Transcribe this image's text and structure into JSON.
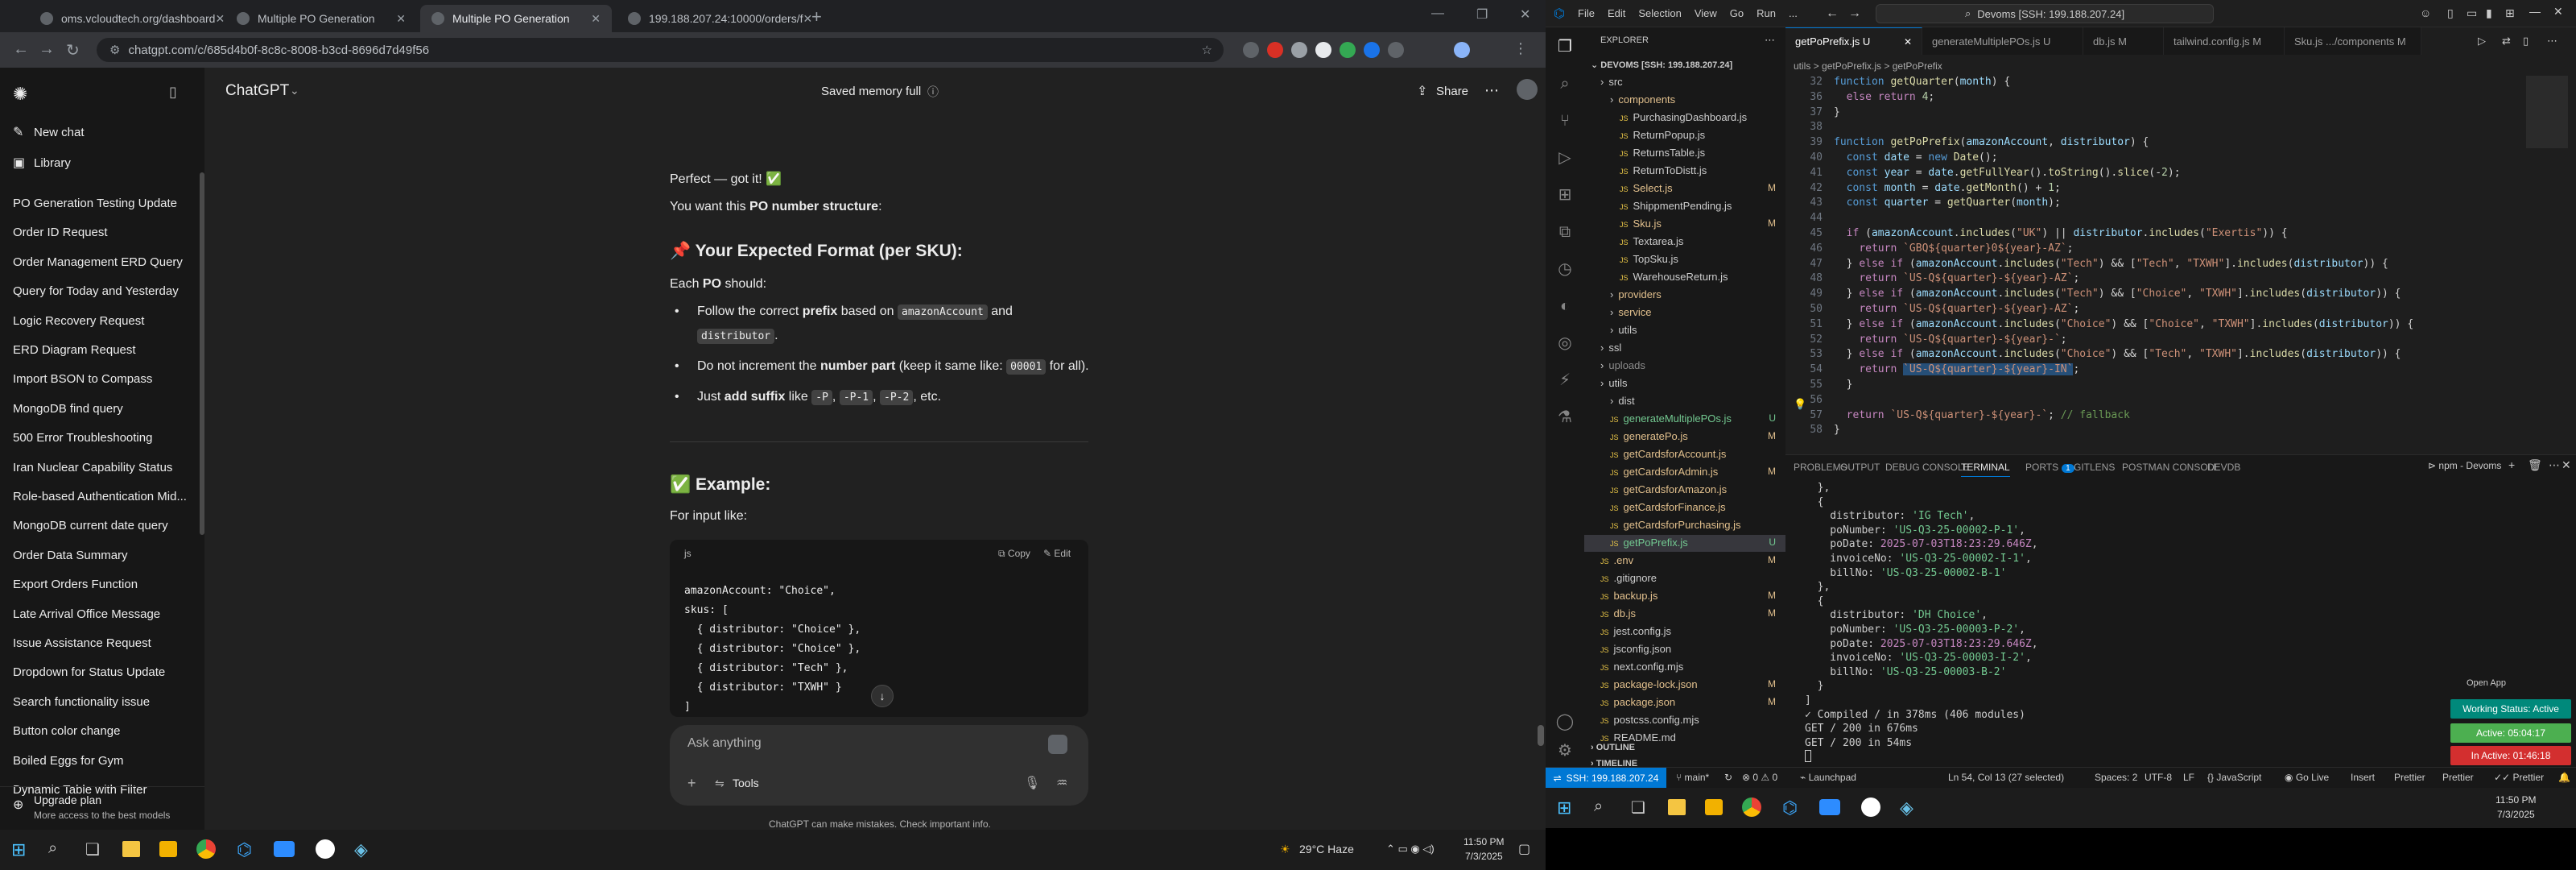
{
  "chrome": {
    "tabs": [
      {
        "label": "oms.vcloudtech.org/dashboard",
        "active": false
      },
      {
        "label": "Multiple PO Generation",
        "active": false
      },
      {
        "label": "Multiple PO Generation",
        "active": true
      },
      {
        "label": "199.188.207.24:10000/orders/f",
        "active": false
      }
    ],
    "new_tab": "+",
    "window_min": "—",
    "window_max": "❐",
    "window_close": "✕",
    "url": "chatgpt.com/c/685d4b0f-8c8c-8008-b3cd-8696d7d49f56"
  },
  "chatgpt": {
    "model_label": "ChatGPT",
    "memory_label": "Saved memory full",
    "share_label": "Share",
    "sidebar": {
      "new_chat": "New chat",
      "library": "Library",
      "chats": [
        "PO Generation Testing Update",
        "Order ID Request",
        "Order Management ERD Query",
        "Query for Today and Yesterday",
        "Logic Recovery Request",
        "ERD Diagram Request",
        "Import BSON to Compass",
        "MongoDB find query",
        "500 Error Troubleshooting",
        "Iran Nuclear Capability Status",
        "Role-based Authentication Mid...",
        "MongoDB current date query",
        "Order Data Summary",
        "Export Orders Function",
        "Late Arrival Office Message",
        "Issue Assistance Request",
        "Dropdown for Status Update",
        "Search functionality issue",
        "Button color change",
        "Boiled Eggs for Gym",
        "Dynamic Table with Filter"
      ],
      "upgrade_title": "Upgrade plan",
      "upgrade_sub": "More access to the best models"
    },
    "message": {
      "line1": "Perfect — got it! ✅",
      "line2_pre": "You want this ",
      "line2_bold": "PO number structure",
      "line2_post": ":",
      "heading1": "📌 Your Expected Format (per SKU):",
      "each_pre": "Each ",
      "each_bold": "PO",
      "each_post": " should:",
      "bullet1_pre": "Follow the correct ",
      "bullet1_bold": "prefix",
      "bullet1_mid": " based on ",
      "bullet1_code1": "amazonAccount",
      "bullet1_and": " and",
      "bullet1_code2": "distributor",
      "bullet1_end": ".",
      "bullet2_pre": "Do not increment the ",
      "bullet2_bold": "number part",
      "bullet2_mid": " (keep it same like: ",
      "bullet2_code": "00001",
      "bullet2_end": " for all).",
      "bullet3_pre": "Just ",
      "bullet3_bold": "add suffix",
      "bullet3_mid": " like ",
      "bullet3_c1": "-P",
      "bullet3_c2": "-P-1",
      "bullet3_c3": "-P-2",
      "bullet3_end": ", etc.",
      "heading2": "✅ Example:",
      "for_input": "For input like:"
    },
    "codeblock": {
      "lang": "js",
      "copy": "Copy",
      "edit": "Edit",
      "lines": [
        "amazonAccount: \"Choice\",",
        "skus: [",
        "  { distributor: \"Choice\" },",
        "  { distributor: \"Choice\" },",
        "  { distributor: \"Tech\" },",
        "  { distributor: \"TXWH\" }",
        "]"
      ]
    },
    "composer": {
      "placeholder": "Ask anything",
      "tools": "Tools"
    },
    "disclaimer": "ChatGPT can make mistakes. Check important info."
  },
  "taskbar_left": {
    "weather": "29°C  Haze",
    "time": "11:50 PM",
    "date": "7/3/2025"
  },
  "vscode": {
    "menu": [
      "File",
      "Edit",
      "Selection",
      "View",
      "Go",
      "Run",
      "..."
    ],
    "search": "Devoms [SSH: 199.188.207.24]",
    "explorer_title": "EXPLORER",
    "root": "DEVOMS [SSH: 199.188.207.24]",
    "tree": [
      {
        "label": "src",
        "indent": 1,
        "kind": "folder",
        "status": ""
      },
      {
        "label": "components",
        "indent": 2,
        "kind": "folder",
        "status": "m"
      },
      {
        "label": "PurchasingDashboard.js",
        "indent": 3,
        "kind": "file",
        "status": ""
      },
      {
        "label": "ReturnPopup.js",
        "indent": 3,
        "kind": "file",
        "status": ""
      },
      {
        "label": "ReturnsTable.js",
        "indent": 3,
        "kind": "file",
        "status": ""
      },
      {
        "label": "ReturnToDistt.js",
        "indent": 3,
        "kind": "file",
        "status": ""
      },
      {
        "label": "Select.js",
        "indent": 3,
        "kind": "file",
        "status": "m",
        "badge": "M"
      },
      {
        "label": "ShippmentPending.js",
        "indent": 3,
        "kind": "file",
        "status": ""
      },
      {
        "label": "Sku.js",
        "indent": 3,
        "kind": "file",
        "status": "m",
        "badge": "M"
      },
      {
        "label": "Textarea.js",
        "indent": 3,
        "kind": "file",
        "status": ""
      },
      {
        "label": "TopSku.js",
        "indent": 3,
        "kind": "file",
        "status": ""
      },
      {
        "label": "WarehouseReturn.js",
        "indent": 3,
        "kind": "file",
        "status": ""
      },
      {
        "label": "providers",
        "indent": 2,
        "kind": "folder",
        "status": "m"
      },
      {
        "label": "service",
        "indent": 2,
        "kind": "folder",
        "status": "m"
      },
      {
        "label": "utils",
        "indent": 2,
        "kind": "folder",
        "status": ""
      },
      {
        "label": "ssl",
        "indent": 1,
        "kind": "folder",
        "status": ""
      },
      {
        "label": "uploads",
        "indent": 1,
        "kind": "folder",
        "status": "dim"
      },
      {
        "label": "utils",
        "indent": 1,
        "kind": "folder",
        "status": ""
      },
      {
        "label": "dist",
        "indent": 2,
        "kind": "folder",
        "status": ""
      },
      {
        "label": "generateMultiplePOs.js",
        "indent": 2,
        "kind": "file",
        "status": "u",
        "badge": "U"
      },
      {
        "label": "generatePo.js",
        "indent": 2,
        "kind": "file",
        "status": "m",
        "badge": "M"
      },
      {
        "label": "getCardsforAccount.js",
        "indent": 2,
        "kind": "file",
        "status": "m"
      },
      {
        "label": "getCardsforAdmin.js",
        "indent": 2,
        "kind": "file",
        "status": "m",
        "badge": "M"
      },
      {
        "label": "getCardsforAmazon.js",
        "indent": 2,
        "kind": "file",
        "status": "m"
      },
      {
        "label": "getCardsforFinance.js",
        "indent": 2,
        "kind": "file",
        "status": "m"
      },
      {
        "label": "getCardsforPurchasing.js",
        "indent": 2,
        "kind": "file",
        "status": "m"
      },
      {
        "label": "getPoPrefix.js",
        "indent": 2,
        "kind": "file",
        "status": "u",
        "badge": "U",
        "selected": true
      },
      {
        "label": ".env",
        "indent": 1,
        "kind": "file",
        "status": "m",
        "badge": "M"
      },
      {
        "label": ".gitignore",
        "indent": 1,
        "kind": "file",
        "status": ""
      },
      {
        "label": "backup.js",
        "indent": 1,
        "kind": "file",
        "status": "m",
        "badge": "M"
      },
      {
        "label": "db.js",
        "indent": 1,
        "kind": "file",
        "status": "m",
        "badge": "M"
      },
      {
        "label": "jest.config.js",
        "indent": 1,
        "kind": "file",
        "status": ""
      },
      {
        "label": "jsconfig.json",
        "indent": 1,
        "kind": "file",
        "status": ""
      },
      {
        "label": "next.config.mjs",
        "indent": 1,
        "kind": "file",
        "status": ""
      },
      {
        "label": "package-lock.json",
        "indent": 1,
        "kind": "file",
        "status": "m",
        "badge": "M"
      },
      {
        "label": "package.json",
        "indent": 1,
        "kind": "file",
        "status": "m",
        "badge": "M"
      },
      {
        "label": "postcss.config.mjs",
        "indent": 1,
        "kind": "file",
        "status": ""
      },
      {
        "label": "README.md",
        "indent": 1,
        "kind": "file",
        "status": ""
      }
    ],
    "outline": "OUTLINE",
    "timeline": "TIMELINE",
    "editor_tabs": [
      {
        "label": "getPoPrefix.js  U",
        "active": true
      },
      {
        "label": "generateMultiplePOs.js  U",
        "active": false
      },
      {
        "label": "db.js  M",
        "active": false
      },
      {
        "label": "tailwind.config.js  M",
        "active": false
      },
      {
        "label": "Sku.js  .../components  M",
        "active": false
      }
    ],
    "breadcrumb": "utils > getPoPrefix.js > getPoPrefix",
    "code_lines": [
      {
        "n": "32",
        "html": "<span class=\"kb\">function</span> <span class=\"fn\">getQuarter</span><span class=\"pl\">(</span><span class=\"vr\">month</span><span class=\"pl\">) {</span>"
      },
      {
        "n": "36",
        "html": "<span class=\"pl\">  </span><span class=\"kw\">else return</span> <span class=\"nm\">4</span><span class=\"pl\">;</span>"
      },
      {
        "n": "37",
        "html": "<span class=\"pl\">}</span>"
      },
      {
        "n": "38",
        "html": ""
      },
      {
        "n": "39",
        "html": "<span class=\"kb\">function</span> <span class=\"fn\">getPoPrefix</span><span class=\"pl\">(</span><span class=\"vr\">amazonAccount</span><span class=\"pl\">, </span><span class=\"vr\">distributor</span><span class=\"pl\">) {</span>"
      },
      {
        "n": "40",
        "html": "<span class=\"pl\">  </span><span class=\"kb\">const</span> <span class=\"vr\">date</span> <span class=\"pl\">= </span><span class=\"kb\">new</span> <span class=\"fn\">Date</span><span class=\"pl\">();</span>"
      },
      {
        "n": "41",
        "html": "<span class=\"pl\">  </span><span class=\"kb\">const</span> <span class=\"vr\">year</span> <span class=\"pl\">= </span><span class=\"vr\">date</span><span class=\"pl\">.</span><span class=\"fn\">getFullYear</span><span class=\"pl\">().</span><span class=\"fn\">toString</span><span class=\"pl\">().</span><span class=\"fn\">slice</span><span class=\"pl\">(-</span><span class=\"nm\">2</span><span class=\"pl\">);</span>"
      },
      {
        "n": "42",
        "html": "<span class=\"pl\">  </span><span class=\"kb\">const</span> <span class=\"vr\">month</span> <span class=\"pl\">= </span><span class=\"vr\">date</span><span class=\"pl\">.</span><span class=\"fn\">getMonth</span><span class=\"pl\">() + </span><span class=\"nm\">1</span><span class=\"pl\">;</span>"
      },
      {
        "n": "43",
        "html": "<span class=\"pl\">  </span><span class=\"kb\">const</span> <span class=\"vr\">quarter</span> <span class=\"pl\">= </span><span class=\"fn\">getQuarter</span><span class=\"pl\">(</span><span class=\"vr\">month</span><span class=\"pl\">);</span>"
      },
      {
        "n": "44",
        "html": ""
      },
      {
        "n": "45",
        "html": "<span class=\"pl\">  </span><span class=\"kw\">if</span><span class=\"pl\"> (</span><span class=\"vr\">amazonAccount</span><span class=\"pl\">.</span><span class=\"fn\">includes</span><span class=\"pl\">(</span><span class=\"st\">\"UK\"</span><span class=\"pl\">) || </span><span class=\"vr\">distributor</span><span class=\"pl\">.</span><span class=\"fn\">includes</span><span class=\"pl\">(</span><span class=\"st\">\"Exertis\"</span><span class=\"pl\">)) {</span>"
      },
      {
        "n": "46",
        "html": "<span class=\"pl\">    </span><span class=\"kw\">return</span> <span class=\"st\">`GBQ${quarter}0${year}-AZ`</span><span class=\"pl\">;</span>"
      },
      {
        "n": "47",
        "html": "<span class=\"pl\">  } </span><span class=\"kw\">else if</span><span class=\"pl\"> (</span><span class=\"vr\">amazonAccount</span><span class=\"pl\">.</span><span class=\"fn\">includes</span><span class=\"pl\">(</span><span class=\"st\">\"Tech\"</span><span class=\"pl\">) &amp;&amp; [</span><span class=\"st\">\"Tech\"</span><span class=\"pl\">, </span><span class=\"st\">\"TXWH\"</span><span class=\"pl\">].</span><span class=\"fn\">includes</span><span class=\"pl\">(</span><span class=\"vr\">distributor</span><span class=\"pl\">)) {</span>"
      },
      {
        "n": "48",
        "html": "<span class=\"pl\">    </span><span class=\"kw\">return</span> <span class=\"st\">`US-Q${quarter}-${year}-AZ`</span><span class=\"pl\">;</span>"
      },
      {
        "n": "49",
        "html": "<span class=\"pl\">  } </span><span class=\"kw\">else if</span><span class=\"pl\"> (</span><span class=\"vr\">amazonAccount</span><span class=\"pl\">.</span><span class=\"fn\">includes</span><span class=\"pl\">(</span><span class=\"st\">\"Tech\"</span><span class=\"pl\">) &amp;&amp; [</span><span class=\"st\">\"Choice\"</span><span class=\"pl\">, </span><span class=\"st\">\"TXWH\"</span><span class=\"pl\">].</span><span class=\"fn\">includes</span><span class=\"pl\">(</span><span class=\"vr\">distributor</span><span class=\"pl\">)) {</span>"
      },
      {
        "n": "50",
        "html": "<span class=\"pl\">    </span><span class=\"kw\">return</span> <span class=\"st\">`US-Q${quarter}-${year}-AZ`</span><span class=\"pl\">;</span>"
      },
      {
        "n": "51",
        "html": "<span class=\"pl\">  } </span><span class=\"kw\">else if</span><span class=\"pl\"> (</span><span class=\"vr\">amazonAccount</span><span class=\"pl\">.</span><span class=\"fn\">includes</span><span class=\"pl\">(</span><span class=\"st\">\"Choice\"</span><span class=\"pl\">) &amp;&amp; [</span><span class=\"st\">\"Choice\"</span><span class=\"pl\">, </span><span class=\"st\">\"TXWH\"</span><span class=\"pl\">].</span><span class=\"fn\">includes</span><span class=\"pl\">(</span><span class=\"vr\">distributor</span><span class=\"pl\">)) {</span>"
      },
      {
        "n": "52",
        "html": "<span class=\"pl\">    </span><span class=\"kw\">return</span> <span class=\"st\">`US-Q${quarter}-${year}-`</span><span class=\"pl\">;</span>"
      },
      {
        "n": "53",
        "html": "<span class=\"pl\">  } </span><span class=\"kw\">else if</span><span class=\"pl\"> (</span><span class=\"vr\">amazonAccount</span><span class=\"pl\">.</span><span class=\"fn\">includes</span><span class=\"pl\">(</span><span class=\"st\">\"Choice\"</span><span class=\"pl\">) &amp;&amp; [</span><span class=\"st\">\"Tech\"</span><span class=\"pl\">, </span><span class=\"st\">\"TXWH\"</span><span class=\"pl\">].</span><span class=\"fn\">includes</span><span class=\"pl\">(</span><span class=\"vr\">distributor</span><span class=\"pl\">)) {</span>"
      },
      {
        "n": "54",
        "html": "<span class=\"pl\">    </span><span class=\"kw\">return</span> <span class=\"st\" style=\"background:#264f78\">`US-Q${quarter}-${year}-IN`</span><span class=\"pl\">;</span>"
      },
      {
        "n": "55",
        "html": "<span class=\"pl\">  }</span>"
      },
      {
        "n": "56",
        "html": ""
      },
      {
        "n": "57",
        "html": "<span class=\"pl\">  </span><span class=\"kw\">return</span> <span class=\"st\">`US-Q${quarter}-${year}-`</span><span class=\"pl\">; </span><span class=\"cm\">// fallback</span>"
      },
      {
        "n": "58",
        "html": "<span class=\"pl\">}</span>"
      }
    ],
    "panel_tabs": [
      "PROBLEMS",
      "OUTPUT",
      "DEBUG CONSOLE",
      "TERMINAL",
      "PORTS",
      "GITLENS",
      "POSTMAN CONSOLE",
      "DEVDB"
    ],
    "ports_count": "1",
    "terminal_name": "npm - Devoms",
    "terminal_lines": [
      {
        "t": "  },",
        "c": "#cccccc"
      },
      {
        "t": "  {",
        "c": "#cccccc"
      },
      {
        "t": "    distributor: 'IG Tech',",
        "c": "#cccccc",
        "hl": "'IG Tech'"
      },
      {
        "t": "    poNumber: 'US-Q3-25-00002-P-1',",
        "c": "#cccccc",
        "hl": "'US-Q3-25-00002-P-1'"
      },
      {
        "t": "    poDate: 2025-07-03T18:23:29.646Z,",
        "c": "#cccccc",
        "hl": "2025-07-03T18:23:29.646Z",
        "hlc": "#c586c0"
      },
      {
        "t": "    invoiceNo: 'US-Q3-25-00002-I-1',",
        "c": "#cccccc",
        "hl": "'US-Q3-25-00002-I-1'"
      },
      {
        "t": "    billNo: 'US-Q3-25-00002-B-1'",
        "c": "#cccccc",
        "hl": "'US-Q3-25-00002-B-1'"
      },
      {
        "t": "  },",
        "c": "#cccccc"
      },
      {
        "t": "  {",
        "c": "#cccccc"
      },
      {
        "t": "    distributor: 'DH Choice',",
        "c": "#cccccc",
        "hl": "'DH Choice'"
      },
      {
        "t": "    poNumber: 'US-Q3-25-00003-P-2',",
        "c": "#cccccc",
        "hl": "'US-Q3-25-00003-P-2'"
      },
      {
        "t": "    poDate: 2025-07-03T18:23:29.646Z,",
        "c": "#cccccc",
        "hl": "2025-07-03T18:23:29.646Z",
        "hlc": "#c586c0"
      },
      {
        "t": "    invoiceNo: 'US-Q3-25-00003-I-2',",
        "c": "#cccccc",
        "hl": "'US-Q3-25-00003-I-2'"
      },
      {
        "t": "    billNo: 'US-Q3-25-00003-B-2'",
        "c": "#cccccc",
        "hl": "'US-Q3-25-00003-B-2'"
      },
      {
        "t": "  }",
        "c": "#cccccc"
      },
      {
        "t": "]",
        "c": "#cccccc"
      },
      {
        "t": "✓ Compiled / in 378ms (406 modules)",
        "c": "#cccccc"
      },
      {
        "t": "GET / 200 in 676ms",
        "c": "#cccccc"
      },
      {
        "t": "GET / 200 in 54ms",
        "c": "#cccccc"
      }
    ],
    "status": {
      "remote": "SSH: 199.188.207.24",
      "branch": "main*",
      "errors": "0",
      "warnings": "0",
      "launchpad": "Launchpad",
      "cursor": "Ln 54, Col 13 (27 selected)",
      "spaces": "Spaces: 2",
      "encoding": "UTF-8",
      "eol": "LF",
      "language": "JavaScript",
      "golive": "Go Live",
      "insert": "Insert",
      "prettier": "Prettier",
      "prettier2": "Prettier",
      "prettier3": "Prettier"
    },
    "open_app": "Open App",
    "working_status": "Working Status: Active",
    "active_time": "Active: 05:04:17",
    "inactive_time": "In Active: 01:46:18"
  },
  "taskbar_right": {
    "time": "11:50 PM",
    "date": "7/3/2025"
  },
  "colors": {
    "vs_blue": "#0078d4",
    "green_status": "#4caf50",
    "red_status": "#d32f2f",
    "teal_status": "#00897b"
  }
}
